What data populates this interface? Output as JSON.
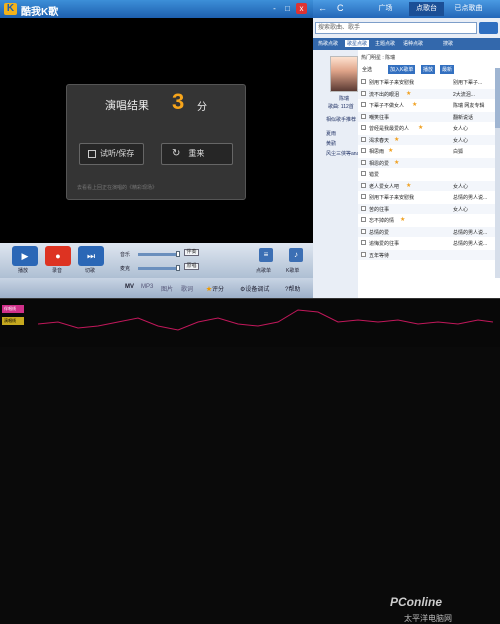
{
  "app": {
    "title": "酷我K歌",
    "logo": "K"
  },
  "window_controls": [
    "-",
    "□",
    "x"
  ],
  "result": {
    "label": "演唱结果",
    "score": "3",
    "unit": "分",
    "listen_save": "试听/保存",
    "retry": "重来",
    "hint": "去看看上回正在演唱的《精彩现场》"
  },
  "controls": {
    "play": "播放",
    "record": "录音",
    "switch": "切歌",
    "accompany": "伴奏",
    "original": "原唱",
    "vol1_label": "音乐",
    "vol2_label": "麦克",
    "box1": "伴奏",
    "box2": "原唱",
    "song_list": "点歌单",
    "sing_list": "K歌单"
  },
  "options": {
    "mv": "MV",
    "mp3": "MP3",
    "pic": "图片",
    "text": "歌词",
    "rate": "评分",
    "device": "设备调试",
    "help": "帮助"
  },
  "pitch": {
    "label1": "伴唱线",
    "label2": "演唱线"
  },
  "watermark": {
    "brand": "PConline",
    "sub": "太平洋电脑网"
  },
  "rpanel": {
    "back": "←",
    "refresh": "C",
    "tabs": [
      "广场",
      "点歌台",
      "已点歌曲"
    ],
    "search_placeholder": "搜索歌曲、歌手",
    "categories": [
      "热歌点歌",
      "歌星点歌",
      "主题点歌",
      "语种点歌",
      "搜歌"
    ],
    "breadcrumb": "热门明星 : 陈瑞",
    "artist_name": "陈瑞",
    "song_count": "歌曲: 112首",
    "tag": "相似歌手推荐",
    "related": [
      "夏雨",
      "黄鹂",
      "风尘三侠等anay"
    ],
    "filters": [
      "全选",
      "加入K歌单",
      "播放",
      "最新"
    ],
    "songs": [
      {
        "title": "别用下辈子来安慰我",
        "star": false,
        "singer": "别用下辈子..."
      },
      {
        "title": "流不出的眼泪",
        "star": true,
        "singer": "2大流泪..."
      },
      {
        "title": "下辈子不做女人",
        "star": true,
        "singer": "陈瑞 网友专辑"
      },
      {
        "title": "嘲笑往事",
        "star": false,
        "singer": "翻新说话"
      },
      {
        "title": "曾经是我最爱的人",
        "star": true,
        "singer": "女人心"
      },
      {
        "title": "渴求春天",
        "star": true,
        "singer": "女人心"
      },
      {
        "title": "相思雨",
        "star": true,
        "singer": "白狐"
      },
      {
        "title": "相恩的爱",
        "star": true,
        "singer": ""
      },
      {
        "title": "错爱",
        "star": false,
        "singer": ""
      },
      {
        "title": "老人爱女人吧",
        "star": true,
        "singer": "女人心"
      },
      {
        "title": "别用下辈子来安慰我",
        "star": false,
        "singer": "总情的男人说..."
      },
      {
        "title": "苦的往事",
        "star": false,
        "singer": "女人心"
      },
      {
        "title": "忘不掉的情",
        "star": true,
        "singer": ""
      },
      {
        "title": "总情的爱",
        "star": false,
        "singer": "总情的男人说..."
      },
      {
        "title": "追悔爱的往事",
        "star": false,
        "singer": "总情的男人说..."
      },
      {
        "title": "五年等待",
        "star": false,
        "singer": ""
      }
    ]
  },
  "colors": {
    "accent": "#2b67b6",
    "score": "#f7a51b",
    "pitch_line": "#c2185b"
  }
}
